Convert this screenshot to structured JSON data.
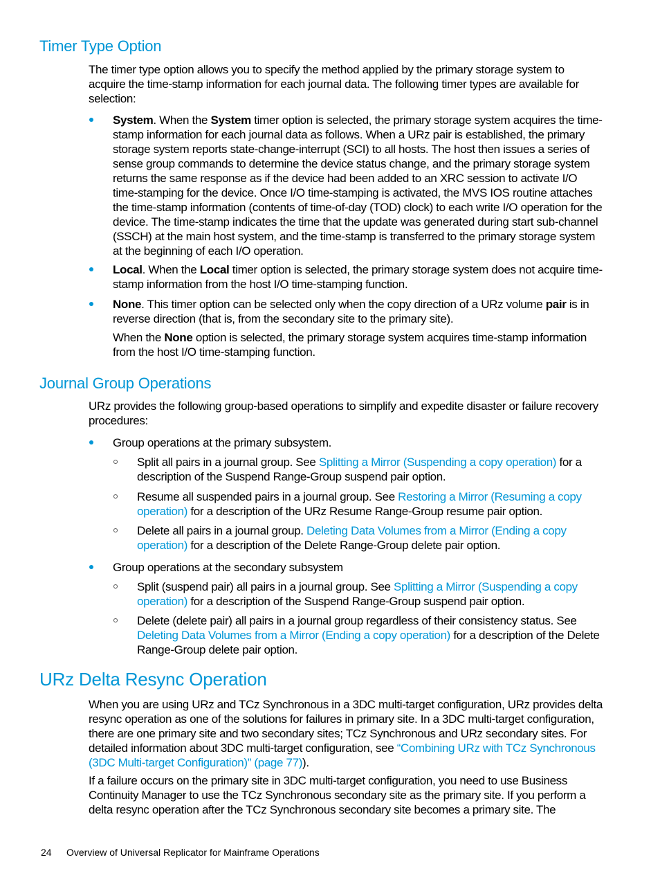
{
  "sections": {
    "timer": {
      "heading": "Timer Type Option",
      "intro": "The timer type option allows you to specify the method applied by the primary storage system to acquire the time-stamp information for each journal data. The following timer types are available for selection:",
      "system": {
        "term": "System",
        "t1": ". When the ",
        "term2": "System",
        "t2": " timer option is selected, the primary storage system acquires the time-stamp information for each journal data as follows. When a URz pair is established, the primary storage system reports state-change-interrupt (SCI) to all hosts. The host then issues a series of sense group commands to determine the device status change, and the primary storage system returns the same response as if the device had been added to an XRC session to activate I/O time-stamping for the device. Once I/O time-stamping is activated, the MVS IOS routine attaches the time-stamp information (contents of time-of-day (TOD) clock) to each write I/O operation for the device. The time-stamp indicates the time that the update was generated during start sub-channel (SSCH) at the main host system, and the time-stamp is transferred to the primary storage system at the beginning of each I/O operation."
      },
      "local": {
        "term": "Local",
        "t1": ". When the ",
        "term2": "Local",
        "t2": " timer option is selected, the primary storage system does not acquire time-stamp information from the host I/O time-stamping function."
      },
      "none": {
        "term": "None",
        "t1": ". This timer option can be selected only when the copy direction of a URz volume ",
        "term2": "pair",
        "t2": " is in reverse direction (that is, from the secondary site to the primary site).",
        "p2a": "When the ",
        "p2term": "None",
        "p2b": " option is selected, the primary storage system acquires time-stamp information from the host I/O time-stamping function."
      }
    },
    "journal": {
      "heading": "Journal Group Operations",
      "intro": "URz provides the following group-based operations to simplify and expedite disaster or failure recovery procedures:",
      "primary": {
        "label": "Group operations at the primary subsystem.",
        "items": [
          {
            "pre": "Split all pairs in a journal group. See ",
            "link": "Splitting a Mirror (Suspending a copy operation)",
            "post": " for a description of the Suspend Range-Group suspend pair option."
          },
          {
            "pre": "Resume all suspended pairs in a journal group. See ",
            "link": "Restoring a Mirror (Resuming a copy operation)",
            "post": " for a description of the URz Resume Range-Group resume pair option."
          },
          {
            "pre": "Delete all pairs in a journal group. ",
            "link": "Deleting Data Volumes from a Mirror (Ending a copy operation)",
            "post": " for a description of the Delete Range-Group delete pair option."
          }
        ]
      },
      "secondary": {
        "label": "Group operations at the secondary subsystem",
        "items": [
          {
            "pre": "Split (suspend pair) all pairs in a journal group. See ",
            "link": "Splitting a Mirror (Suspending a copy operation)",
            "post": " for a description of the Suspend Range-Group suspend pair option."
          },
          {
            "pre": "Delete (delete pair) all pairs in a journal group regardless of their consistency status. See ",
            "link": "Deleting Data Volumes from a Mirror (Ending a copy operation)",
            "post": " for a description of the Delete Range-Group delete pair option."
          }
        ]
      }
    },
    "delta": {
      "heading": "URz Delta Resync Operation",
      "p1_pre": "When you are using URz and TCz Synchronous in a 3DC multi-target configuration, URz provides delta resync operation as one of the solutions for failures in primary site. In a 3DC multi-target configuration, there are one primary site and two secondary sites; TCz Synchronous and URz secondary sites. For detailed information about 3DC multi-target configuration, see ",
      "p1_link": "“Combining URz with TCz Synchronous (3DC Multi-target Configuration)” (page 77)",
      "p1_post": ").",
      "p2": "If a failure occurs on the primary site in 3DC multi-target configuration, you need to use Business Continuity Manager to use the TCz Synchronous secondary site as the primary site. If you perform a delta resync operation after the TCz Synchronous secondary site becomes a primary site. The"
    }
  },
  "footer": {
    "page_number": "24",
    "title": "Overview of Universal Replicator for Mainframe Operations"
  }
}
